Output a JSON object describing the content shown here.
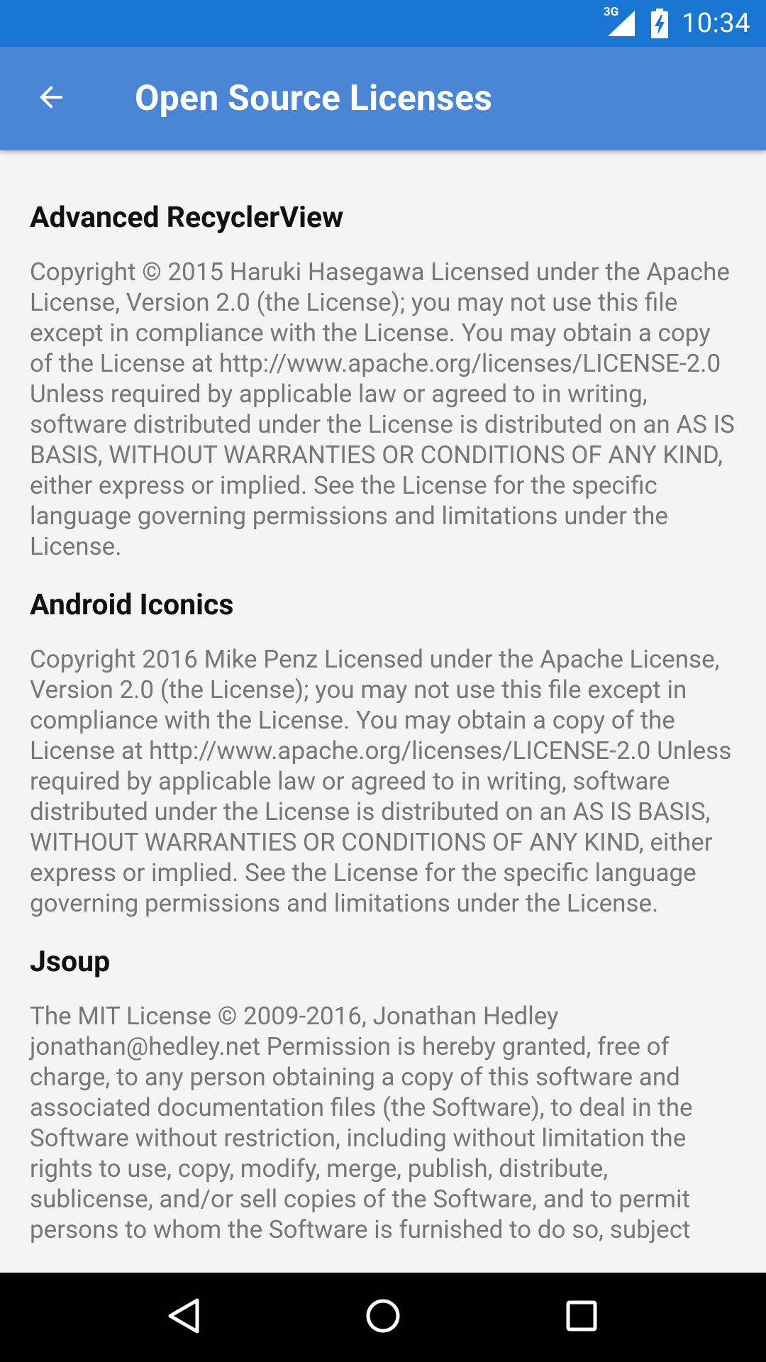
{
  "status_bar": {
    "network": "3G",
    "time": "10:34"
  },
  "app_bar": {
    "title": "Open Source Licenses"
  },
  "licenses": [
    {
      "name": "Advanced RecyclerView",
      "text": "Copyright © 2015 Haruki Hasegawa Licensed under the Apache License, Version 2.0 (the License); you may not use this file except in compliance with the License. You may obtain a copy of the License at http://www.apache.org/licenses/LICENSE-2.0 Unless required by applicable law or agreed to in writing, software distributed under the License is distributed on an AS IS BASIS, WITHOUT WARRANTIES OR CONDITIONS OF ANY KIND, either express or implied. See the License for the specific language governing permissions and limitations under the License."
    },
    {
      "name": "Android Iconics",
      "text": "Copyright 2016 Mike Penz Licensed under the Apache License, Version 2.0 (the License); you may not use this file except in compliance with the License. You may obtain a copy of the License at http://www.apache.org/licenses/LICENSE-2.0 Unless required by applicable law or agreed to in writing, software distributed under the License is distributed on an AS IS BASIS, WITHOUT WARRANTIES OR CONDITIONS OF ANY KIND, either express or implied. See the License for the specific language governing permissions and limitations under the License."
    },
    {
      "name": "Jsoup",
      "text": "The MIT License © 2009-2016, Jonathan Hedley jonathan@hedley.net Permission is hereby granted, free of charge, to any person obtaining a copy of this software and associated documentation files (the Software), to deal in the Software without restriction, including without limitation the rights to use, copy, modify, merge, publish, distribute, sublicense, and/or sell copies of the Software, and to permit persons to whom the Software is furnished to do so, subject"
    }
  ],
  "colors": {
    "status_bar": "#1976d2",
    "app_bar": "#4a85d6",
    "background": "#f4f4f4",
    "body_text": "#777777"
  }
}
